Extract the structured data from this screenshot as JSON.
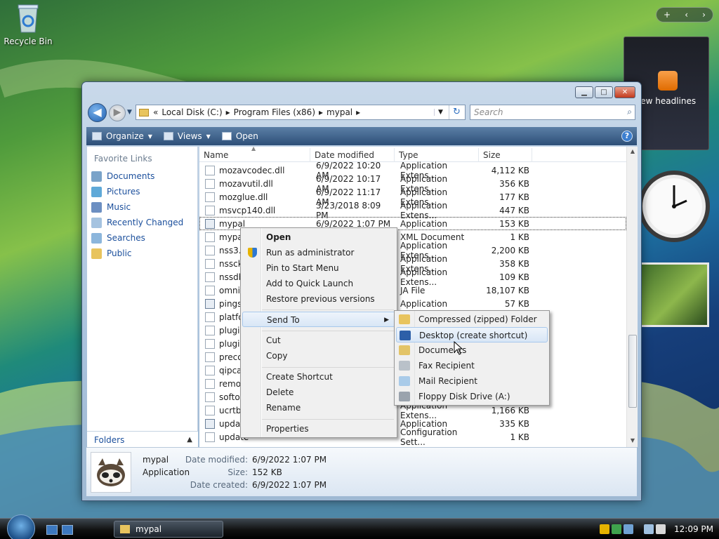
{
  "desktop": {
    "recycle_bin": "Recycle Bin"
  },
  "gadgets": {
    "feed_label": "iew headlines",
    "bar_add": "+",
    "bar_prev": "‹",
    "bar_next": "›"
  },
  "window": {
    "address": {
      "root": "«",
      "segments": [
        "Local Disk (C:)",
        "Program Files (x86)",
        "mypal"
      ]
    },
    "search_placeholder": "Search",
    "toolbar": {
      "organize": "Organize",
      "views": "Views",
      "open": "Open",
      "help": "?"
    },
    "nav": {
      "favorite_links": "Favorite Links",
      "links": [
        "Documents",
        "Pictures",
        "Music",
        "Recently Changed",
        "Searches",
        "Public"
      ],
      "folders": "Folders"
    },
    "columns": {
      "name": "Name",
      "date": "Date modified",
      "type": "Type",
      "size": "Size"
    },
    "files": [
      {
        "name": "mozavcodec.dll",
        "date": "6/9/2022 10:20 AM",
        "type": "Application Extens...",
        "size": "4,112 KB"
      },
      {
        "name": "mozavutil.dll",
        "date": "6/9/2022 10:17 AM",
        "type": "Application Extens...",
        "size": "356 KB"
      },
      {
        "name": "mozglue.dll",
        "date": "6/9/2022 11:17 AM",
        "type": "Application Extens...",
        "size": "177 KB"
      },
      {
        "name": "msvcp140.dll",
        "date": "3/23/2018 8:09 PM",
        "type": "Application Extens...",
        "size": "447 KB"
      },
      {
        "name": "mypal",
        "date": "6/9/2022 1:07 PM",
        "type": "Application",
        "size": "153 KB"
      },
      {
        "name": "mypal",
        "date": "",
        "type": "XML Document",
        "size": "1 KB"
      },
      {
        "name": "nss3.d",
        "date": "",
        "type": "Application Extens...",
        "size": "2,200 KB"
      },
      {
        "name": "nssckb",
        "date": "",
        "type": "Application Extens...",
        "size": "358 KB"
      },
      {
        "name": "nssdbr",
        "date": "",
        "type": "Application Extens...",
        "size": "109 KB"
      },
      {
        "name": "omni.j",
        "date": "",
        "type": "JA File",
        "size": "18,107 KB"
      },
      {
        "name": "pingse",
        "date": "",
        "type": "Application",
        "size": "57 KB"
      },
      {
        "name": "platfor",
        "date": "",
        "type": "",
        "size": ""
      },
      {
        "name": "plugin",
        "date": "",
        "type": "",
        "size": ""
      },
      {
        "name": "plugin",
        "date": "",
        "type": "",
        "size": ""
      },
      {
        "name": "precor",
        "date": "",
        "type": "",
        "size": ""
      },
      {
        "name": "qipcap",
        "date": "",
        "type": "",
        "size": ""
      },
      {
        "name": "remov",
        "date": "",
        "type": "",
        "size": ""
      },
      {
        "name": "softok",
        "date": "",
        "type": "",
        "size": ""
      },
      {
        "name": "ucrtba",
        "date": "",
        "type": "Application Extens...",
        "size": "1,166 KB"
      },
      {
        "name": "update",
        "date": "",
        "type": "Application",
        "size": "335 KB"
      },
      {
        "name": "update",
        "date": "",
        "type": "Configuration Sett...",
        "size": "1 KB"
      }
    ],
    "details": {
      "name": "mypal",
      "type": "Application",
      "date_modified_label": "Date modified:",
      "date_modified": "6/9/2022 1:07 PM",
      "size_label": "Size:",
      "size": "152 KB",
      "date_created_label": "Date created:",
      "date_created": "6/9/2022 1:07 PM"
    }
  },
  "context_menu": {
    "open": "Open",
    "run_admin": "Run as administrator",
    "pin_start": "Pin to Start Menu",
    "quick_launch": "Add to Quick Launch",
    "restore": "Restore previous versions",
    "send_to": "Send To",
    "cut": "Cut",
    "copy": "Copy",
    "create_shortcut": "Create Shortcut",
    "delete": "Delete",
    "rename": "Rename",
    "properties": "Properties"
  },
  "send_to_menu": [
    "Compressed (zipped) Folder",
    "Desktop (create shortcut)",
    "Documents",
    "Fax Recipient",
    "Mail Recipient",
    "Floppy Disk Drive (A:)"
  ],
  "taskbar": {
    "task": "mypal",
    "time": "12:09 PM"
  }
}
